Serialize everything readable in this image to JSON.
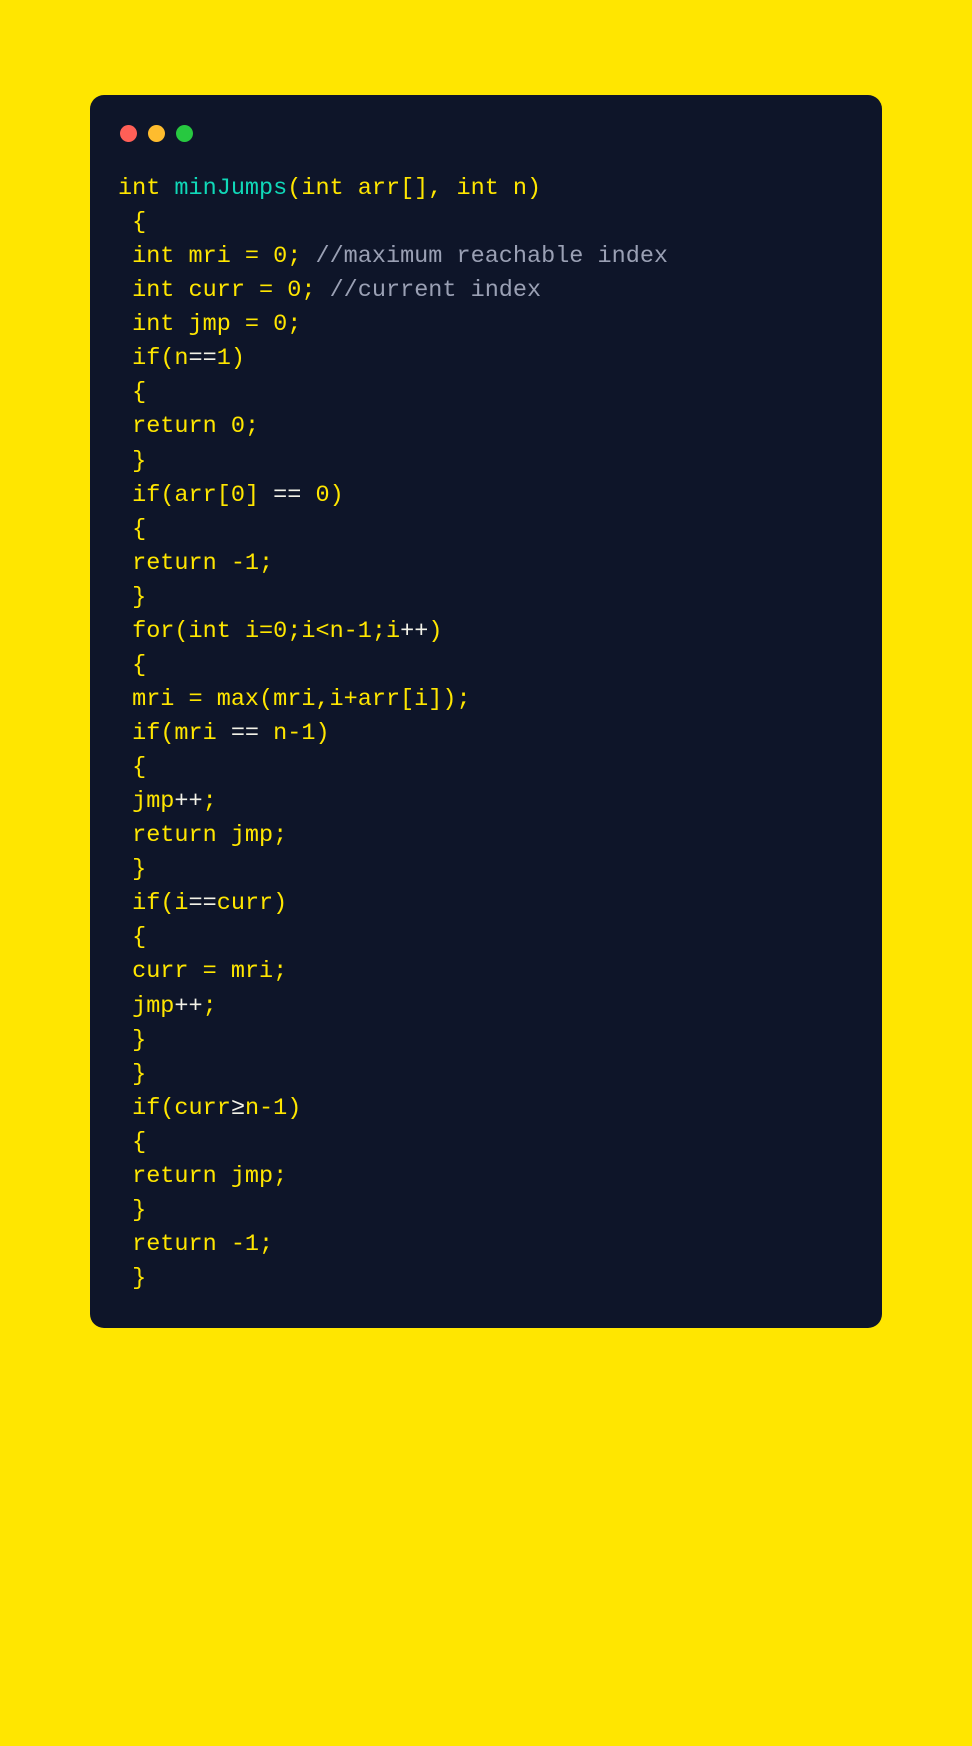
{
  "traffic": {
    "red": "#ff5f57",
    "yellow": "#febc2e",
    "green": "#27c840"
  },
  "code": {
    "l1_a": "int",
    "l1_b": " minJumps",
    "l1_c": "(",
    "l1_d": "int",
    "l1_e": " arr[], ",
    "l1_f": "int",
    "l1_g": " n)",
    "l2": " {",
    "l3_a": " int",
    "l3_b": " mri = ",
    "l3_c": "0",
    "l3_d": "; ",
    "l3_e": "//maximum reachable index",
    "l4_a": " int",
    "l4_b": " curr = ",
    "l4_c": "0",
    "l4_d": "; ",
    "l4_e": "//current index",
    "l5_a": " int",
    "l5_b": " jmp = ",
    "l5_c": "0",
    "l5_d": ";",
    "l6_a": " if",
    "l6_b": "(n",
    "l6_c": "==",
    "l6_d": "1",
    "l6_e": ")",
    "l7": " {",
    "l8_a": " return ",
    "l8_b": "0",
    "l8_c": ";",
    "l9": " }",
    "l10_a": " if",
    "l10_b": "(arr[",
    "l10_c": "0",
    "l10_d": "] ",
    "l10_e": "==",
    "l10_f": " ",
    "l10_g": "0",
    "l10_h": ")",
    "l11": " {",
    "l12_a": " return ",
    "l12_b": "-1",
    "l12_c": ";",
    "l13": " }",
    "l14_a": " for",
    "l14_b": "(",
    "l14_c": "int",
    "l14_d": " i=",
    "l14_e": "0",
    "l14_f": ";i<n-",
    "l14_g": "1",
    "l14_h": ";i",
    "l14_i": "++",
    "l14_j": ")",
    "l15": " {",
    "l16_a": " mri = max(mri,i+arr[i]);",
    "l17_a": " if",
    "l17_b": "(mri ",
    "l17_c": "==",
    "l17_d": " n-",
    "l17_e": "1",
    "l17_f": ")",
    "l18": " {",
    "l19_a": " jmp",
    "l19_b": "++",
    "l19_c": ";",
    "l20_a": " return",
    "l20_b": " jmp;",
    "l21": " }",
    "l22_a": " if",
    "l22_b": "(i",
    "l22_c": "==",
    "l22_d": "curr)",
    "l23": " {",
    "l24": " curr = mri;",
    "l25_a": " jmp",
    "l25_b": "++",
    "l25_c": ";",
    "l26": " }",
    "l27": " }",
    "l28_a": " if",
    "l28_b": "(curr",
    "l28_c": "≥",
    "l28_d": "n-",
    "l28_e": "1",
    "l28_f": ")",
    "l29": " {",
    "l30_a": " return",
    "l30_b": " jmp;",
    "l31": " }",
    "l32_a": " return ",
    "l32_b": "-1",
    "l32_c": ";",
    "l33": " }"
  }
}
